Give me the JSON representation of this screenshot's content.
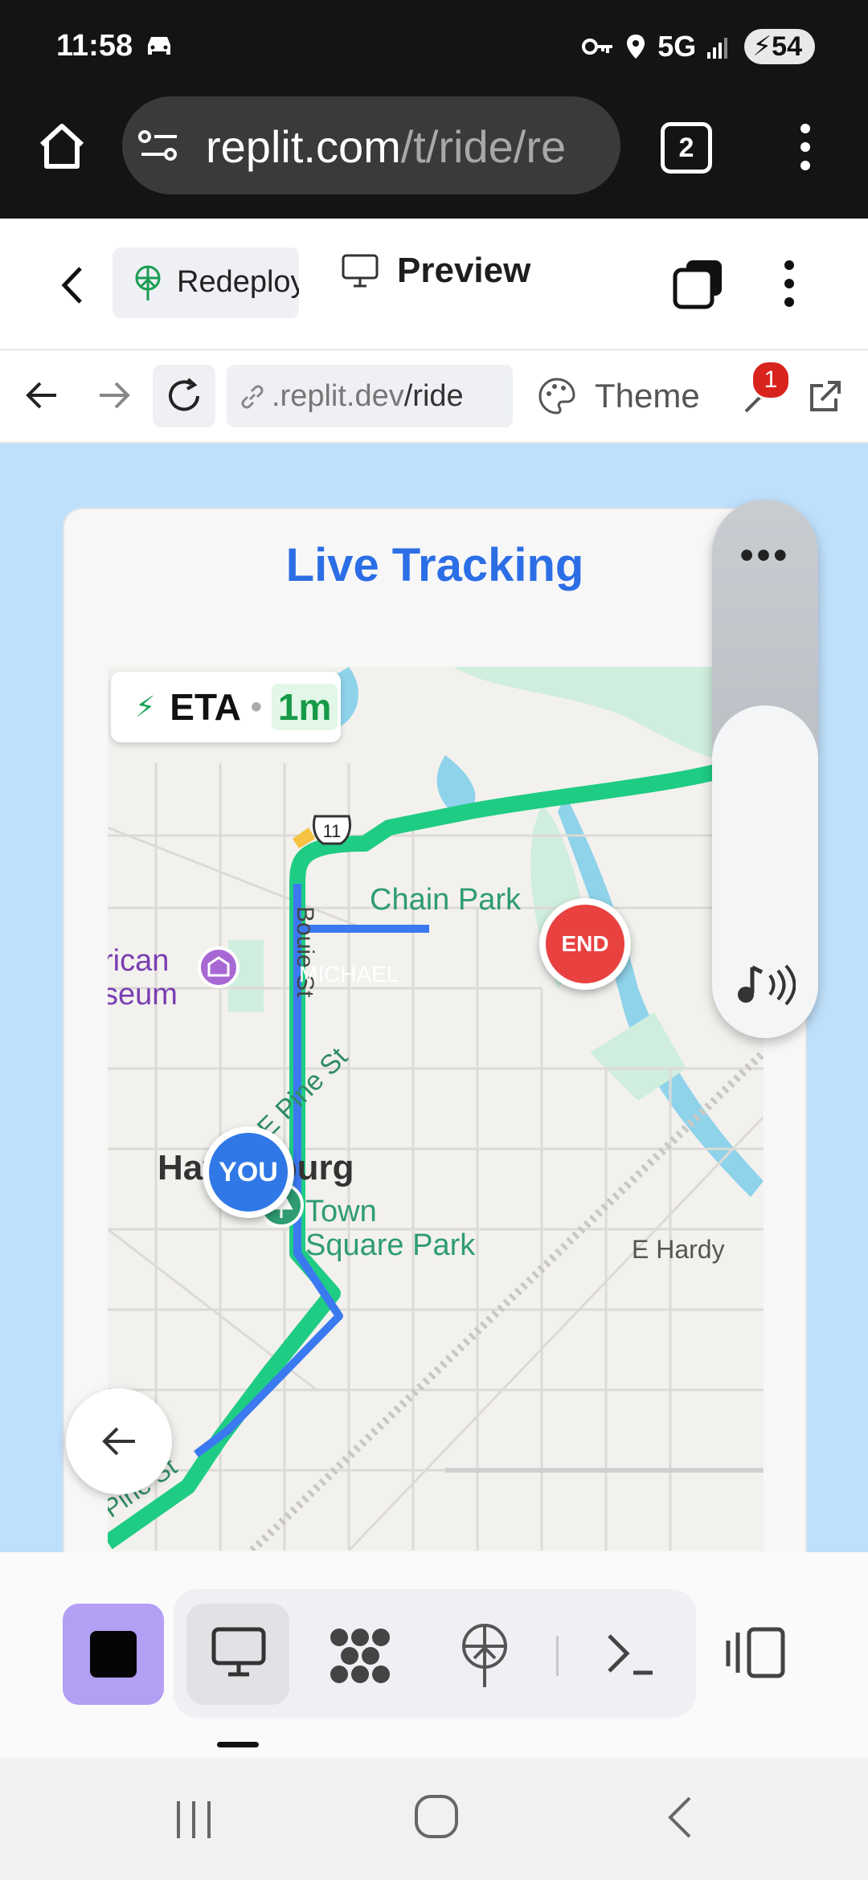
{
  "status_bar": {
    "time": "11:58",
    "network": "5G",
    "battery": "54"
  },
  "browser": {
    "url_host": "replit.com",
    "url_path": "/t/ride/re",
    "tab_count": "2"
  },
  "replit_header": {
    "redeploy_label": "Redeploy",
    "preview_label": "Preview"
  },
  "preview_nav": {
    "url_prefix": ".replit.dev",
    "url_path": "/ride",
    "theme_label": "Theme",
    "badge_count": "1"
  },
  "card": {
    "title": "Live Tracking",
    "eta_label": "ETA",
    "eta_value": "1m"
  },
  "map": {
    "highway_shield": "11",
    "labels": {
      "park_north": "Chain Park",
      "street_vertical": "Bouie St",
      "district": "MICHAEL",
      "museum_1": "rican",
      "museum_2": "seum",
      "street_diag": "E Pine St",
      "city": "Hattiesburg",
      "town_square_1": "Town",
      "town_square_2": "Square Park",
      "hardy": "E Hardy",
      "pine_sw": "Pine St"
    },
    "end_marker": "END",
    "you_marker": "YOU",
    "colors": {
      "route_blue": "#3b79f0",
      "traffic_green": "#1fcc84",
      "water": "#8fd3ea",
      "park": "#cfeedd"
    }
  },
  "toolbar": {
    "icons": [
      "stop-icon",
      "monitor-icon",
      "agent-icon",
      "deploy-icon",
      "terminal-icon",
      "panels-icon"
    ]
  }
}
